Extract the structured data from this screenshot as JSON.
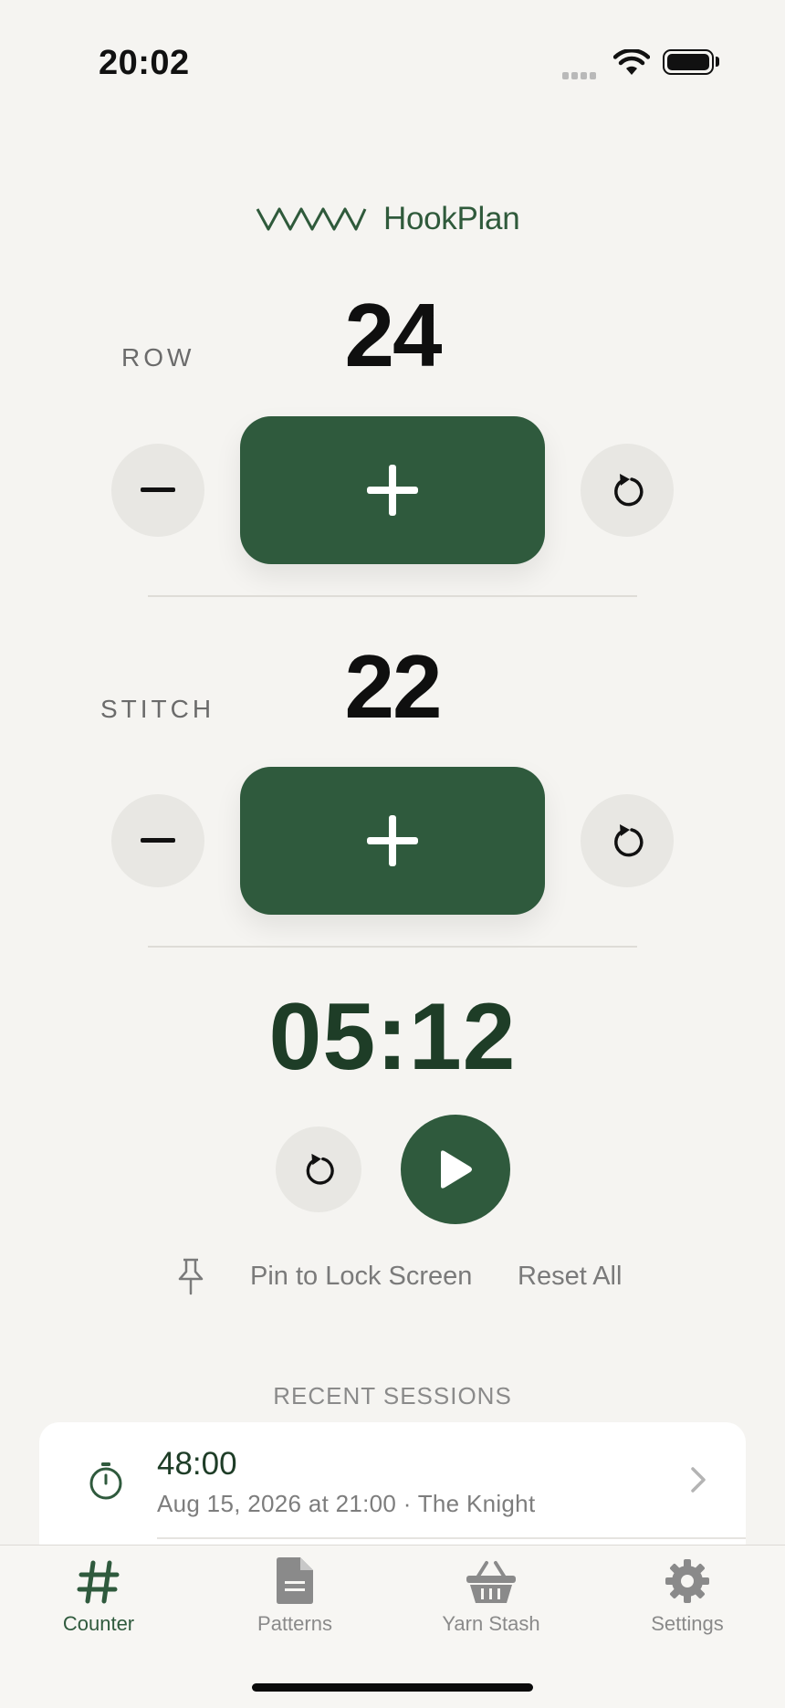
{
  "status_bar": {
    "time": "20:02"
  },
  "app": {
    "name": "HookPlan"
  },
  "row_counter": {
    "label": "ROW",
    "value": "24"
  },
  "stitch_counter": {
    "label": "STITCH",
    "value": "22"
  },
  "timer": {
    "display": "05:12"
  },
  "actions": {
    "pin_label": "Pin to Lock Screen",
    "reset_all_label": "Reset All"
  },
  "recent_sessions": {
    "title": "RECENT SESSIONS",
    "items": [
      {
        "duration": "48:00",
        "detail": "Aug 15, 2026 at 21:00 · The Knight"
      }
    ]
  },
  "tabs": [
    {
      "label": "Counter",
      "icon": "hash-icon",
      "active": true
    },
    {
      "label": "Patterns",
      "icon": "document-icon",
      "active": false
    },
    {
      "label": "Yarn Stash",
      "icon": "basket-icon",
      "active": false
    },
    {
      "label": "Settings",
      "icon": "gear-icon",
      "active": false
    }
  ],
  "colors": {
    "accent": "#2f5a3d",
    "background": "#f5f4f1",
    "secondary_button": "#e8e7e3"
  }
}
